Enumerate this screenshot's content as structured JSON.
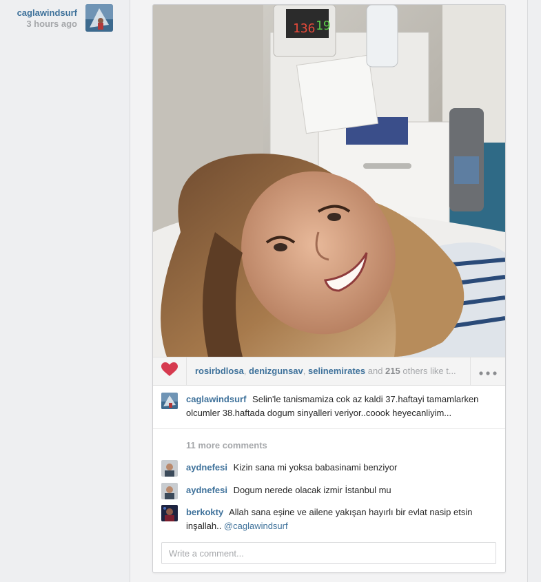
{
  "post": {
    "author": "caglawindsurf",
    "time_ago": "3 hours ago"
  },
  "likes": {
    "likers": [
      "rosirbdlosa",
      "denizgunsav",
      "selinemirates"
    ],
    "sep1": ", ",
    "sep2": ", ",
    "and_text": " and ",
    "count": "215",
    "others_text": " others like t..."
  },
  "more_menu_icon": "ellipsis-icon",
  "heart_icon": "heart-icon",
  "caption": {
    "user": "caglawindsurf",
    "text": "Selin'le tanismamiza cok az kaldi 37.haftayi tamamlarken olcumler 38.haftada dogum sinyalleri veriyor..coook heyecanliyim..."
  },
  "more_comments": "11 more comments",
  "comments": [
    {
      "user": "aydnefesi",
      "text": "Kizin sana mi yoksa babasinami benziyor"
    },
    {
      "user": "aydnefesi",
      "text": "Dogum nerede olacak izmir İstanbul mu"
    },
    {
      "user": "berkokty",
      "text": "Allah sana eşine ve ailene yakışan hayırlı bir evlat nasip etsin inşallah.. ",
      "mention": "@caglawindsurf"
    }
  ],
  "comment_input": {
    "placeholder": "Write a comment..."
  },
  "photo": {
    "monitor_left": "136",
    "monitor_right": "19"
  },
  "colors": {
    "link": "#3f729b",
    "muted": "#a5a7aa",
    "heart": "#d63a4f"
  }
}
